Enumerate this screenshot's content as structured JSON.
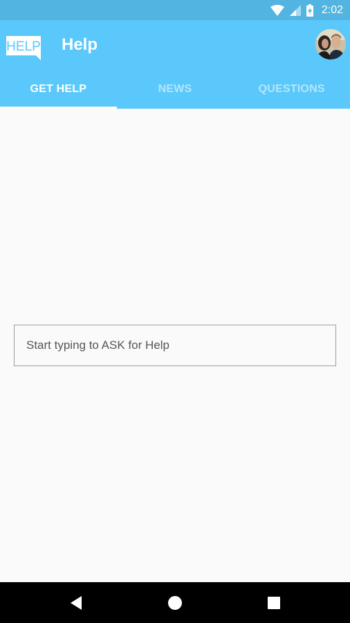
{
  "status_bar": {
    "time": "2:02",
    "icons": [
      "wifi-icon",
      "signal-icon",
      "battery-charging-icon"
    ]
  },
  "app_bar": {
    "logo_text": "HELP",
    "title": "Help",
    "avatar_icon": "profile-photo"
  },
  "tabs": [
    {
      "label": "GET HELP",
      "active": true
    },
    {
      "label": "NEWS",
      "active": false
    },
    {
      "label": "QUESTIONS",
      "active": false
    }
  ],
  "ask": {
    "placeholder": "Start typing to ASK for Help",
    "value": ""
  },
  "nav_bar": {
    "icons": [
      "back-icon",
      "home-icon",
      "recents-icon"
    ]
  },
  "colors": {
    "status_bar": "#52b4e0",
    "app_bar": "#5ac8fa",
    "background": "#fafafa",
    "nav_bar": "#000000"
  }
}
